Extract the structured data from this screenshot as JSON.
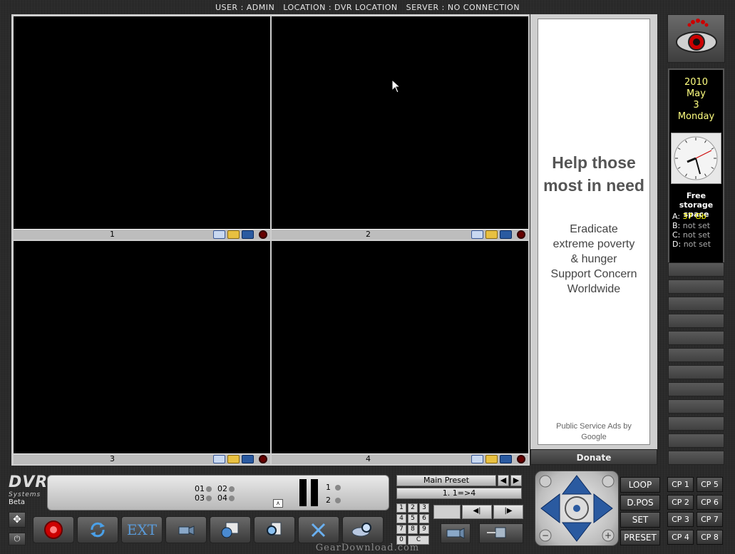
{
  "header": {
    "user": "USER : ADMIN",
    "location": "LOCATION : DVR LOCATION",
    "server": "SERVER : NO CONNECTION"
  },
  "cameras": [
    {
      "label": "1"
    },
    {
      "label": "2"
    },
    {
      "label": "3"
    },
    {
      "label": "4"
    }
  ],
  "ad": {
    "title_line1": "Help those",
    "title_line2": "most in need",
    "body_lines": [
      "Eradicate",
      "extreme poverty",
      "& hunger",
      "Support Concern",
      "Worldwide"
    ],
    "footer_line1": "Public Service Ads by",
    "footer_line2": "Google",
    "donate_label": "Donate"
  },
  "calendar": {
    "year": "2010",
    "month": "May",
    "day": "3",
    "weekday": "Monday"
  },
  "storage": {
    "title_line1": "Free storage",
    "title_line2": "space",
    "drives": [
      {
        "letter": "A:",
        "value": "37 Gb"
      },
      {
        "letter": "B:",
        "value": "not set"
      },
      {
        "letter": "C:",
        "value": "not set"
      },
      {
        "letter": "D:",
        "value": "not set"
      }
    ]
  },
  "brand": {
    "name": "DVR",
    "sub": "Systems",
    "edition": "Beta"
  },
  "status": {
    "ch01": "01",
    "ch02": "02",
    "ch03": "03",
    "ch04": "04",
    "mon1": "1",
    "mon2": "2"
  },
  "toolbar": {
    "ext_label": "EXT"
  },
  "preset": {
    "name": "Main Preset",
    "mapping": "1. 1=>4",
    "keys": [
      "1",
      "2",
      "3",
      "4",
      "5",
      "6",
      "7",
      "8",
      "9",
      "0",
      "C"
    ]
  },
  "commands": {
    "loop": "LOOP",
    "dpos": "D.POS",
    "set": "SET",
    "preset": "PRESET"
  },
  "cp_buttons": [
    "CP 1",
    "CP 5",
    "CP 2",
    "CP 6",
    "CP 3",
    "CP 7",
    "CP 4",
    "CP 8"
  ],
  "watermark": "GearDownload.com",
  "colors": {
    "date_text": "#ffff80",
    "drive_value": "#ffff00",
    "record_red": "#cc0000",
    "accent_blue": "#5a9ad8"
  }
}
